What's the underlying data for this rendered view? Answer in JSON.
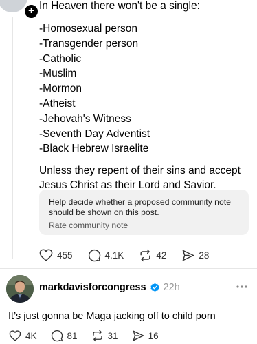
{
  "post": {
    "heading": "In Heaven there won't be a single:",
    "list": [
      "-Homosexual person",
      "-Transgender person",
      "-Catholic",
      "-Muslim",
      "-Mormon",
      "-Atheist",
      "-Jehovah's Witness",
      "-Seventh Day Adventist",
      "-Black Hebrew Israelite"
    ],
    "closing": "Unless they repent of their sins and accept Jesus Christ as their Lord and Savior."
  },
  "community_note": {
    "text": "Help decide whether a proposed community note should be shown on this post.",
    "link": "Rate community note"
  },
  "post_actions": {
    "likes": "455",
    "replies": "4.1K",
    "reposts": "42",
    "shares": "28"
  },
  "reply": {
    "username": "markdavisforcongress",
    "time": "22h",
    "text": "It’s just gonna be Maga jacking off to child porn",
    "likes": "4K",
    "replies": "81",
    "reposts": "31",
    "shares": "16"
  },
  "colors": {
    "verified": "#0095f6",
    "muted": "#9a9a9a",
    "note_bg": "#f1f1f1"
  },
  "icons": [
    "plus-icon",
    "heart-icon",
    "comment-icon",
    "repost-icon",
    "share-icon",
    "verified-badge-icon",
    "more-options-icon"
  ]
}
